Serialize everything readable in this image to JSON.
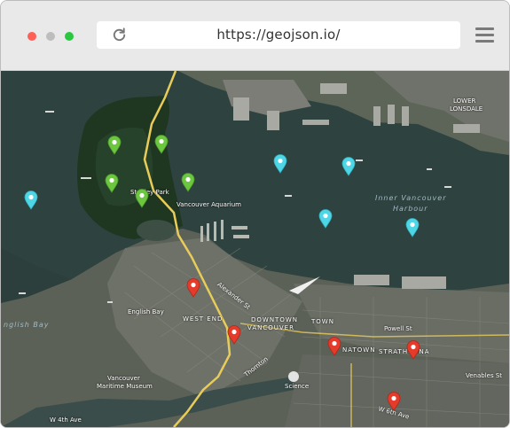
{
  "browser": {
    "url": "https://geojson.io/",
    "icons": {
      "reload": "reload-icon",
      "menu": "hamburger-menu-icon"
    }
  },
  "map": {
    "labels": {
      "stanley_park": "Stanley Park",
      "vancouver_aquarium": "Vancouver Aquarium",
      "inner_harbour_1": "Inner Vancouver",
      "inner_harbour_2": "Harbour",
      "english_bay_beach": "English Bay",
      "english_bay_water": "nglish Bay",
      "west_end": "WEST END",
      "downtown_1": "DOWNTOWN",
      "downtown_2": "VANCOUVER",
      "chinatown": "NATOWN",
      "town": "TOWN",
      "strathcona": "STRATHCONA",
      "maritime_1": "Vancouver",
      "maritime_2": "Maritime Museum",
      "gastown_street": "Alexander St",
      "thornton": "Thornton",
      "venables": "Venables St",
      "powell": "Powell St",
      "lower_lonsdale_1": "LOWER",
      "lower_lonsdale_2": "LONSDALE",
      "science_world": "Science",
      "west_ave": "W 4th Ave",
      "w_4th": "W 6th Ave"
    },
    "marker_colors": {
      "green": "#6cc640",
      "cyan": "#4fd6e6",
      "red": "#e53b2a"
    },
    "markers_green": [
      "green",
      "green",
      "green",
      "green",
      "green"
    ],
    "markers_cyan": [
      "cyan",
      "cyan",
      "cyan",
      "cyan",
      "cyan"
    ],
    "markers_red": [
      "red",
      "red",
      "red",
      "red",
      "red"
    ]
  }
}
